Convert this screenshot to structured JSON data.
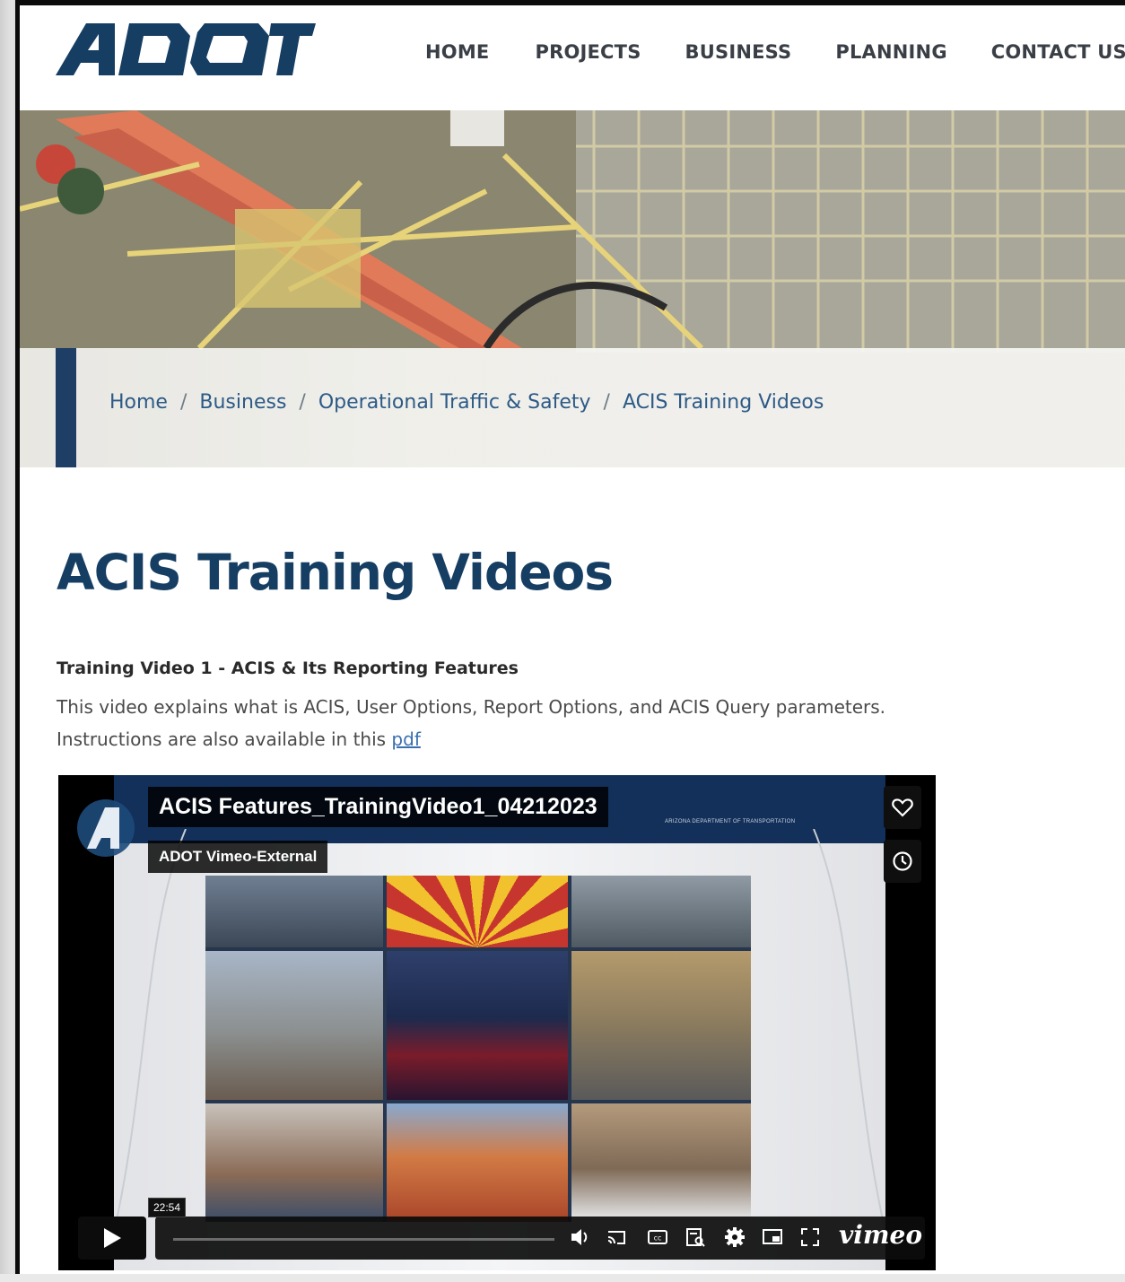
{
  "header": {
    "logo_alt": "ADOT",
    "nav": [
      {
        "label": "HOME"
      },
      {
        "label": "PROJECTS"
      },
      {
        "label": "BUSINESS"
      },
      {
        "label": "PLANNING"
      },
      {
        "label": "CONTACT US"
      }
    ]
  },
  "breadcrumb": {
    "items": [
      "Home",
      "Business",
      "Operational Traffic & Safety",
      "ACIS Training Videos"
    ],
    "separator": "/"
  },
  "page": {
    "title": "ACIS Training Videos",
    "section_title": "Training Video 1 - ACIS & Its Reporting Features",
    "description": "This video explains what is ACIS, User Options, Report Options, and ACIS Query parameters.",
    "instructions_prefix": "Instructions are also available in this ",
    "pdf_link": "pdf"
  },
  "video": {
    "title": "ACIS Features_TrainingVideo1_04212023",
    "channel": "ADOT Vimeo-External",
    "band_text": "ARIZONA DEPARTMENT OF TRANSPORTATION",
    "duration": "22:54",
    "brand": "vimeo",
    "icons": [
      "heart-icon",
      "clock-icon",
      "play-icon",
      "volume-icon",
      "cast-icon",
      "cc-icon",
      "transcript-icon",
      "settings-icon",
      "pip-icon",
      "fullscreen-icon"
    ]
  },
  "colors": {
    "brand_navy": "#163e63",
    "link": "#3a6fb0",
    "breadcrumb": "#2d5a86",
    "accent": "#1e3e66"
  }
}
